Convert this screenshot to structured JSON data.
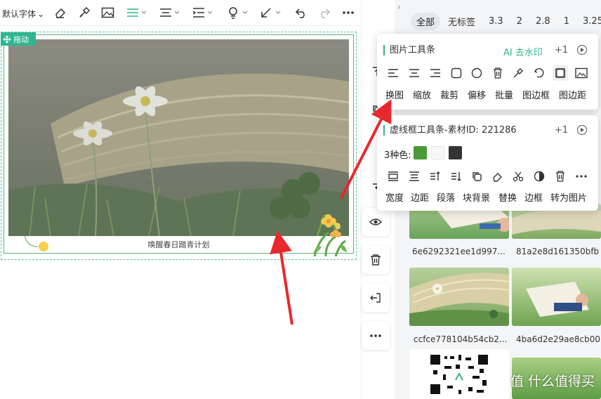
{
  "toolbar": {
    "font_label": "默认字体",
    "icons": [
      "eraser-icon",
      "brush-icon",
      "image-icon",
      "align-icon",
      "line-spacing-icon",
      "indent-icon",
      "bulb-icon",
      "arrow-icon",
      "undo-icon",
      "redo-icon",
      "more-icon"
    ]
  },
  "canvas": {
    "drag_label": "拖动",
    "caption": "唤醒春日踏青计划"
  },
  "side_rail": [
    "align-top-icon",
    "copy-icon",
    "save-icon",
    "wrap-icon",
    "eye-icon",
    "trash-icon",
    "exit-icon",
    "more-icon"
  ],
  "panel": {
    "tags": [
      "全部",
      "无标签",
      "3.3",
      "2",
      "2.8",
      "1",
      "3.25"
    ],
    "thumb_ids": [
      "6e6292321ee1d997...",
      "81a2e8d161350bfb",
      "ccfce778104b54cb2...",
      "4ba6d2e29ae8cb00"
    ]
  },
  "image_toolbar": {
    "title": "图片工具条",
    "ai_label": "AI 去水印",
    "plus": "+1",
    "labels": [
      "换图",
      "缩放",
      "裁剪",
      "偏移",
      "批量",
      "图边框",
      "图边距"
    ]
  },
  "frame_toolbar": {
    "title": "虚线框工具条-素材ID: 221286",
    "plus": "+1",
    "colors_label": "3种色:",
    "colors": [
      "#4a9a35",
      "#f7f7f7",
      "#333333"
    ],
    "labels": [
      "宽度",
      "边距",
      "段落",
      "块背景",
      "替换",
      "边框",
      "转为图片"
    ]
  },
  "watermark": "值 什么值得买",
  "colors": {
    "accent": "#2fb58f",
    "frame_green": "#5ab573",
    "arrow_red": "#e8282d"
  }
}
